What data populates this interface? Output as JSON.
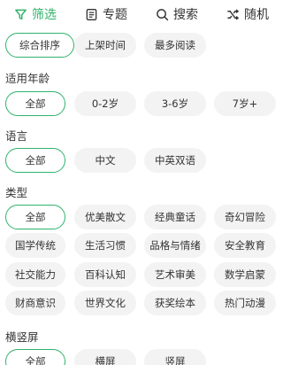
{
  "nav": {
    "items": [
      {
        "label": "筛选",
        "icon": "filter-icon",
        "active": true
      },
      {
        "label": "专题",
        "icon": "book-icon",
        "active": false
      },
      {
        "label": "搜索",
        "icon": "search-icon",
        "active": false
      },
      {
        "label": "随机",
        "icon": "shuffle-icon",
        "active": false
      }
    ]
  },
  "sort": {
    "options": [
      "综合排序",
      "上架时间",
      "最多阅读"
    ],
    "selected": "综合排序"
  },
  "age": {
    "title": "适用年龄",
    "options": [
      "全部",
      "0-2岁",
      "3-6岁",
      "7岁+"
    ],
    "selected": "全部"
  },
  "language": {
    "title": "语言",
    "options": [
      "全部",
      "中文",
      "中英双语"
    ],
    "selected": "全部"
  },
  "category": {
    "title": "类型",
    "options": [
      "全部",
      "优美散文",
      "经典童话",
      "奇幻冒险",
      "国学传统",
      "生活习惯",
      "品格与情绪",
      "安全教育",
      "社交能力",
      "百科认知",
      "艺术审美",
      "数学启蒙",
      "财商意识",
      "世界文化",
      "获奖绘本",
      "热门动漫"
    ],
    "selected": "全部"
  },
  "orientation": {
    "title": "横竖屏",
    "options": [
      "全部",
      "横屏",
      "竖屏"
    ],
    "selected": "全部"
  },
  "colors": {
    "accent": "#2fb36a",
    "chip_bg": "#f3f3f3"
  }
}
